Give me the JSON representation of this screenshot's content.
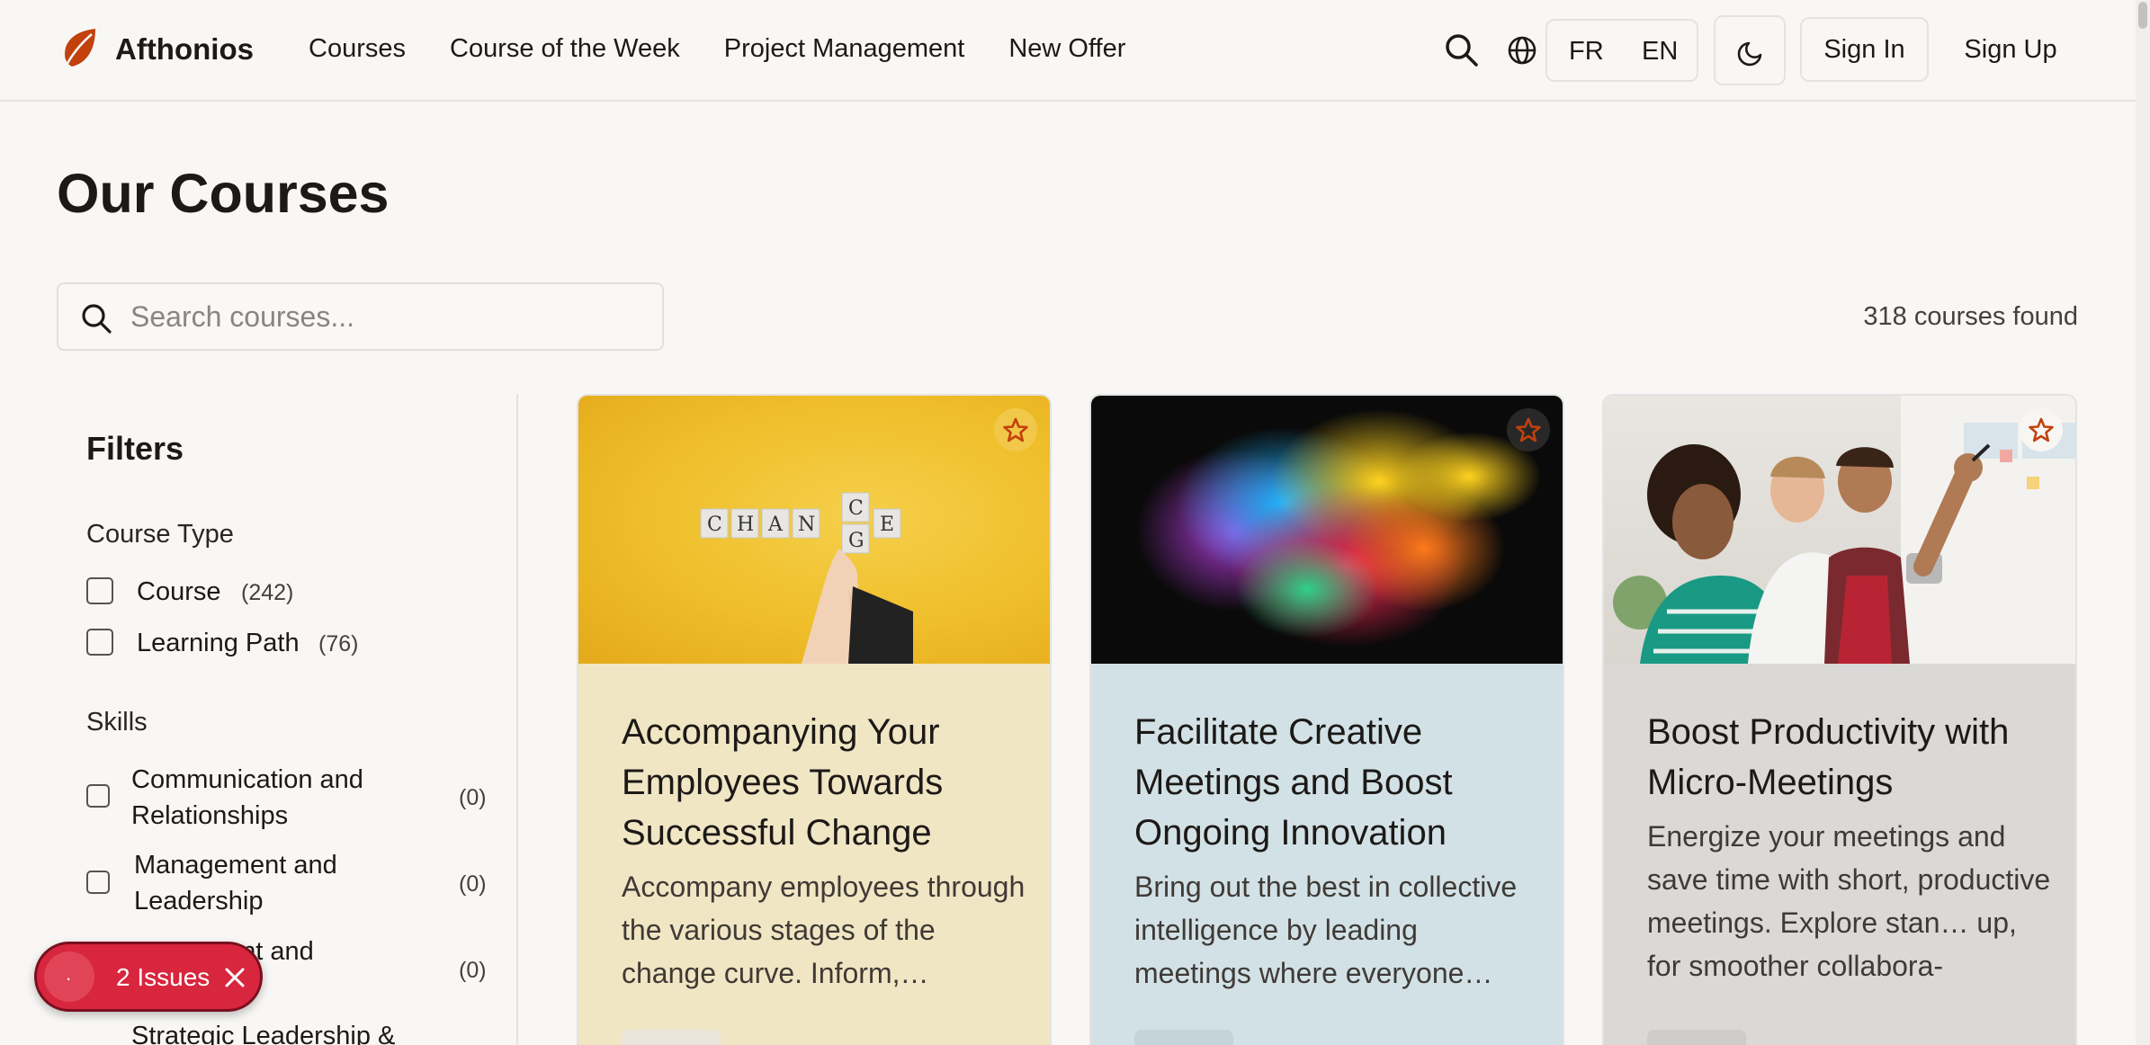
{
  "header": {
    "brand": "Afthonios",
    "nav": [
      "Courses",
      "Course of the Week",
      "Project Management",
      "New Offer"
    ],
    "lang_fr": "FR",
    "lang_en": "EN",
    "sign_in": "Sign In",
    "sign_up": "Sign Up",
    "icons": [
      "leaf-logo",
      "search-icon",
      "globe-icon",
      "moon-icon"
    ]
  },
  "page": {
    "title": "Our Courses",
    "search_placeholder": "Search courses...",
    "results": "318 courses found"
  },
  "filters": {
    "title": "Filters",
    "course_type": {
      "title": "Course Type",
      "options": [
        {
          "label": "Course",
          "count": "(242)"
        },
        {
          "label": "Learning Path",
          "count": "(76)"
        }
      ]
    },
    "skills": {
      "title": "Skills",
      "options": [
        {
          "label": "Communication and Relationships",
          "count": "(0)"
        },
        {
          "label": "Management and Leadership",
          "count": "(0)"
        },
        {
          "label": "ent and",
          "count": "(0)"
        },
        {
          "label": "Strategic Leadership &",
          "count": ""
        }
      ]
    }
  },
  "issues": {
    "label": "2 Issues",
    "dot": "."
  },
  "cards": [
    {
      "title": "Accompanying Your Employees Towards Successful Change",
      "description": "Accompany employees through the various stages of the change curve. Inform,…",
      "image_text": [
        "C",
        "H",
        "A",
        "N",
        "C",
        "G",
        "E"
      ],
      "bg": "#f0e6c4"
    },
    {
      "title": "Facilitate Creative Meetings and Boost Ongoing Innovation",
      "description": "Bring out the best in collec­tive intelligence by leading meetings where everyone…",
      "bg": "#d2e1e5"
    },
    {
      "title": "Boost Productivity with Micro-Meetings",
      "description": "Energize your meetings and save time with short, produc­tive meetings. Explore stan… up, for smoother collabora-",
      "bg": "#dad9d8"
    }
  ],
  "colors": {
    "accent": "#c2410c",
    "issues_red": "#d7263d",
    "background": "#f8f7f5"
  }
}
